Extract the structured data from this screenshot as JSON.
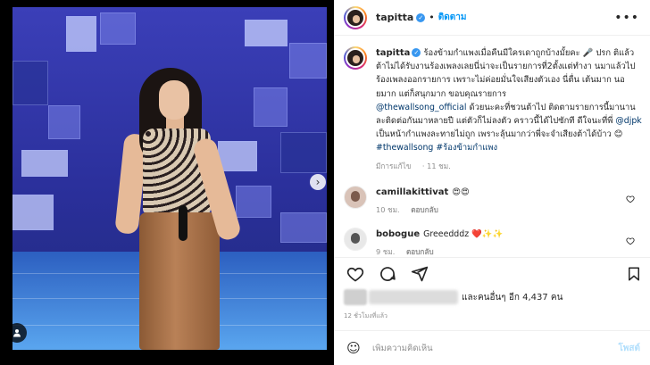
{
  "post": {
    "username": "tapitta",
    "follow_label": "ติดตาม",
    "separator": "•",
    "more_label": "•••",
    "carousel_next": "›"
  },
  "caption": {
    "username": "tapitta",
    "text_part1": "ร้องข้ามกำแพงเมื่อคืนมีใครเดาถูกบ้างมั้ยคะ 🎤 ปรก ติแล้วต้าไม่ได้รับงานร้องเพลงเลยนี่น่าจะเป็นรายการที่2ตั้งแต่ทำงา นมาแล้วไปร้องเพลงออกรายการ เพราะไม่ค่อยมั่นใจเสียงตัวเอง นี่ตื่น เต้นมาก นอยมาก แต่ก็สนุกมาก ขอบคุณรายการ",
    "mention1": "@thewallsong_official",
    "text_part2": " ด้วยนะคะที่ชวนต้าไป ติดตามรายการนี้มานาน ละติดต่อกันมาหลายปี แต่ตัวก็ไม่ลงตัว คราวนี้ได้ไปซักที ดีใจนะที่พี่ ",
    "mention2": "@djpk",
    "text_part3": " เป็นหน้ากำแพงละทายไม่ถูก เพราะลุ้นมากว่าพี่จะจำเสียงต้าได้บ้าว 😊 ",
    "hashtag1": "#thewallsong",
    "hashtag2": " #ร้องข้ามกำแพง",
    "edited_label": "มีการแก้ไข",
    "time": "11 ชม."
  },
  "comments": [
    {
      "username": "camillakittivat",
      "text": "😍😍",
      "time": "10 ชม.",
      "reply_label": "ตอบกลับ"
    },
    {
      "username": "bobogue",
      "text": "Greeedddz ❤️✨✨",
      "time": "9 ชม.",
      "reply_label": "ตอบกลับ"
    }
  ],
  "likes": {
    "text": "และคนอื่นๆ อีก 4,437 คน"
  },
  "timestamp": "12 ชั่วโมงที่แล้ว",
  "composer": {
    "placeholder": "เพิ่มความคิดเห็น",
    "post_label": "โพสต์",
    "emoji": "☺"
  },
  "colors": {
    "accent_blue": "#0095f6",
    "verified": "#3897f0",
    "secondary_text": "#8e8e8e"
  },
  "icons": {
    "like": "heart-icon",
    "comment": "comment-icon",
    "share": "share-icon",
    "save": "bookmark-icon",
    "verified": "verified-badge-icon",
    "tags": "user-tag-icon"
  }
}
